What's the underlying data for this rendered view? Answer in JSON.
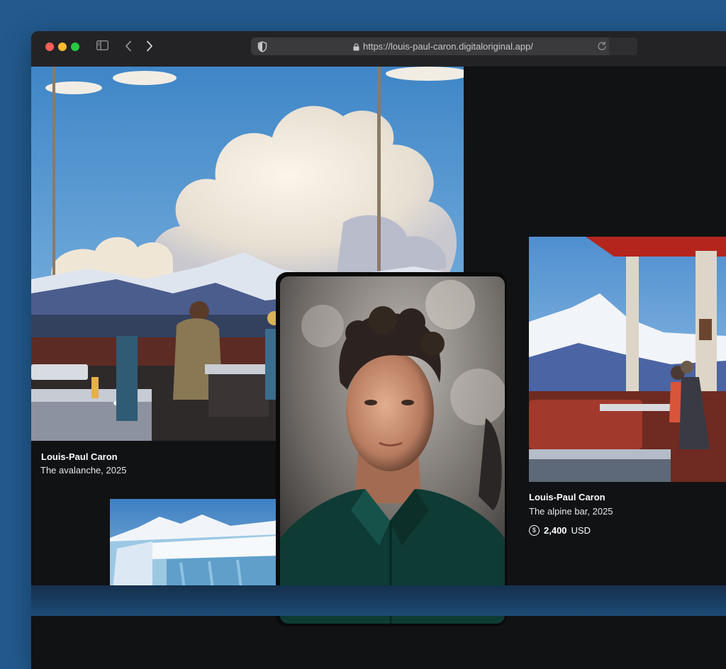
{
  "browser": {
    "url": "https://louis-paul-caron.digitaloriginal.app/"
  },
  "artworks": [
    {
      "artist": "Louis-Paul Caron",
      "title_year": "The avalanche, 2025"
    },
    {
      "artist": "Louis-Paul Caron",
      "title_year": "The alpine bar, 2025",
      "price_value": "2,400",
      "price_currency": "USD"
    }
  ],
  "icons": [
    "shield-icon",
    "lock-icon",
    "reload-icon",
    "sidebar-icon",
    "back-icon",
    "forward-icon",
    "dollar-coin-icon"
  ],
  "colors": {
    "page_bg": "#225a8e",
    "site_bg": "#111214",
    "close": "#ff5f57",
    "minimize": "#febc2e",
    "zoom": "#28c840"
  }
}
